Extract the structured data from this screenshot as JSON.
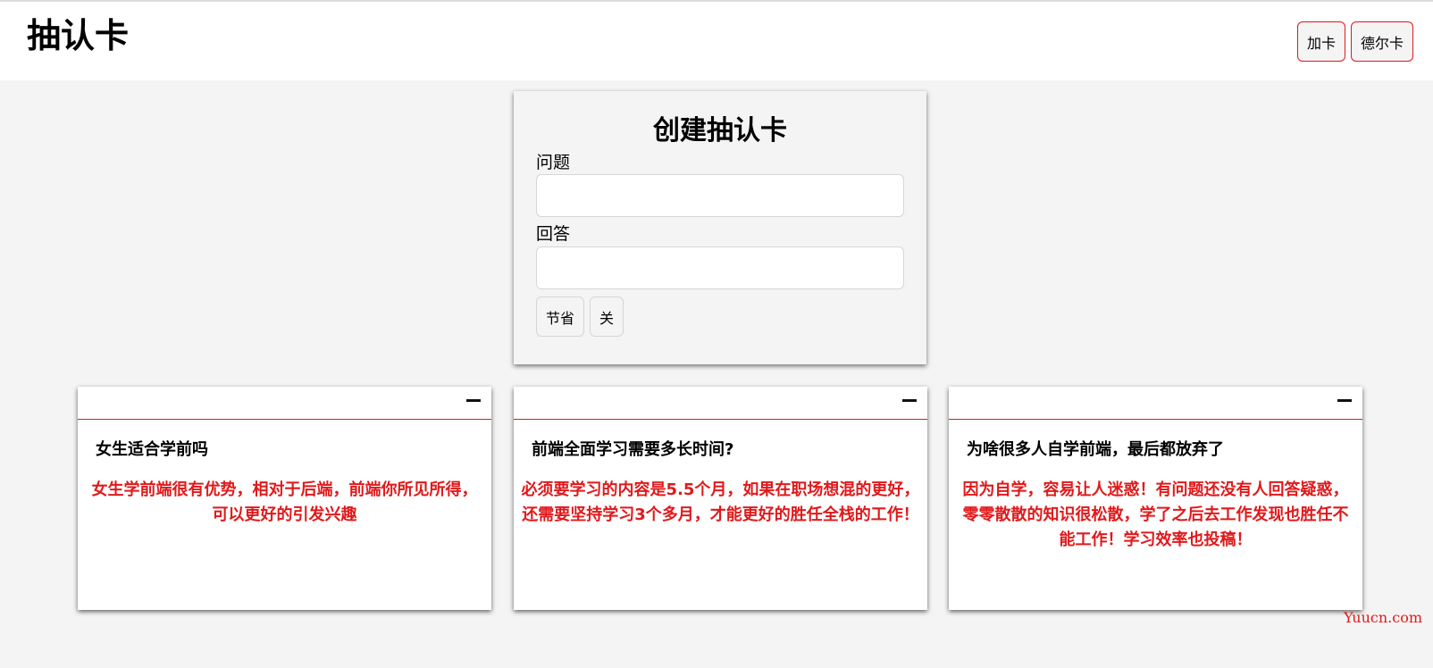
{
  "header": {
    "title": "抽认卡",
    "add_card_label": "加卡",
    "delete_card_label": "德尔卡"
  },
  "form": {
    "title": "创建抽认卡",
    "question_label": "问题",
    "question_value": "",
    "answer_label": "回答",
    "answer_value": "",
    "save_label": "节省",
    "close_label": "关"
  },
  "cards": [
    {
      "question": "女生适合学前吗",
      "answer": "女生学前端很有优势，相对于后端，前端你所见所得，可以更好的引发兴趣"
    },
    {
      "question": "前端全面学习需要多长时间?",
      "answer": "必须要学习的内容是5.5个月，如果在职场想混的更好，还需要坚持学习3个多月，才能更好的胜任全栈的工作！"
    },
    {
      "question": "为啥很多人自学前端，最后都放弃了",
      "answer": "因为自学，容易让人迷惑！有问题还没有人回答疑惑，零零散散的知识很松散，学了之后去工作发现也胜任不能工作！学习效率也投稿！"
    }
  ],
  "watermark": "Yuucn.com",
  "colors": {
    "accent_red": "#e0191b",
    "page_bg": "#f4f4f4",
    "header_bg": "#ffffff"
  }
}
